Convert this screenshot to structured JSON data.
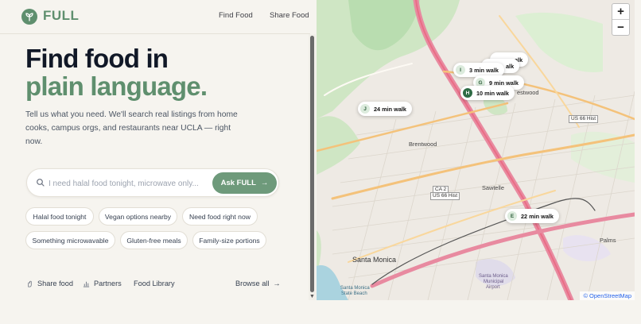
{
  "brand": {
    "name": "FULL"
  },
  "nav": {
    "find_food": "Find Food",
    "share_food": "Share Food"
  },
  "hero": {
    "line1": "Find food in",
    "line2": "plain language.",
    "description": "Tell us what you need. We'll search real listings from home cooks, campus orgs, and restaurants near UCLA — right now."
  },
  "search": {
    "placeholder": "I need halal food tonight, microwave only...",
    "button_label": "Ask FULL"
  },
  "suggestions": [
    "Halal food tonight",
    "Vegan options nearby",
    "Need food right now",
    "Something microwavable",
    "Gluten-free meals",
    "Family-size portions"
  ],
  "footer": {
    "share_food": "Share food",
    "partners": "Partners",
    "food_library": "Food Library",
    "browse_all": "Browse all"
  },
  "map": {
    "zoom_in": "+",
    "zoom_out": "−",
    "attribution": "© OpenStreetMap",
    "labels": {
      "brentwood": "Brentwood",
      "westwood": "estwood",
      "sawtelle": "Sawtelle",
      "santa_monica": "Santa Monica",
      "palms": "Palms",
      "airport1": "Santa Monica",
      "airport2": "Municipal",
      "airport3": "Airport",
      "beach1": "Santa Monica",
      "beach2": "State Beach"
    },
    "shields": {
      "s1": "US 66 Hist",
      "s2": "CA 2",
      "s3": "US 66 Hist",
      "s4": "CA 2"
    },
    "pins": [
      {
        "letter": "I",
        "label": "3 min walk"
      },
      {
        "letter": "G",
        "label": "9 min walk"
      },
      {
        "letter": "H",
        "label": "10 min walk"
      },
      {
        "letter": "J",
        "label": "24 min walk"
      },
      {
        "letter": "E",
        "label": "22 min walk"
      },
      {
        "letter": "",
        "label": "alk"
      },
      {
        "letter": "",
        "label": "alk"
      }
    ]
  },
  "colors": {
    "accent": "#5f8f6e",
    "button": "#6e9a7b",
    "heading": "#111827"
  }
}
